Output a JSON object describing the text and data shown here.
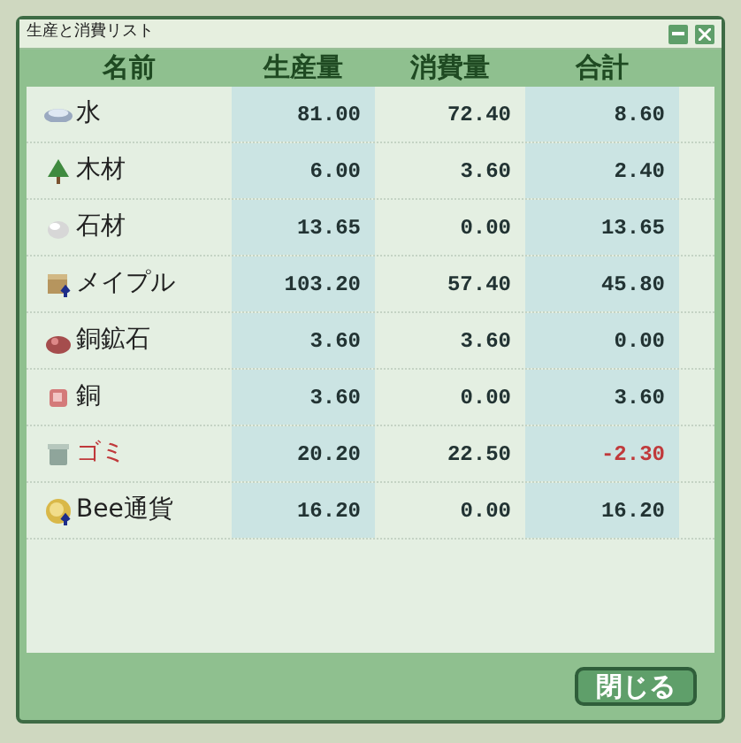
{
  "window": {
    "title": "生産と消費リスト"
  },
  "columns": [
    "名前",
    "生産量",
    "消費量",
    "合計"
  ],
  "rows": [
    {
      "kind": "water",
      "name": "水",
      "produced": "81.00",
      "consumed": "72.40",
      "total": "8.60",
      "shortage": false
    },
    {
      "kind": "tree",
      "name": "木材",
      "produced": "6.00",
      "consumed": "3.60",
      "total": "2.40",
      "shortage": false
    },
    {
      "kind": "stone",
      "name": "石材",
      "produced": "13.65",
      "consumed": "0.00",
      "total": "13.65",
      "shortage": false
    },
    {
      "kind": "crate",
      "name": "メイプル",
      "produced": "103.20",
      "consumed": "57.40",
      "total": "45.80",
      "shortage": false
    },
    {
      "kind": "ore",
      "name": "銅鉱石",
      "produced": "3.60",
      "consumed": "3.60",
      "total": "0.00",
      "shortage": false
    },
    {
      "kind": "ingot",
      "name": "銅",
      "produced": "3.60",
      "consumed": "0.00",
      "total": "3.60",
      "shortage": false
    },
    {
      "kind": "bin",
      "name": "ゴミ",
      "produced": "20.20",
      "consumed": "22.50",
      "total": "-2.30",
      "shortage": true
    },
    {
      "kind": "coin",
      "name": "Bee通貨",
      "produced": "16.20",
      "consumed": "0.00",
      "total": "16.20",
      "shortage": false
    }
  ],
  "close_button": "閉じる"
}
